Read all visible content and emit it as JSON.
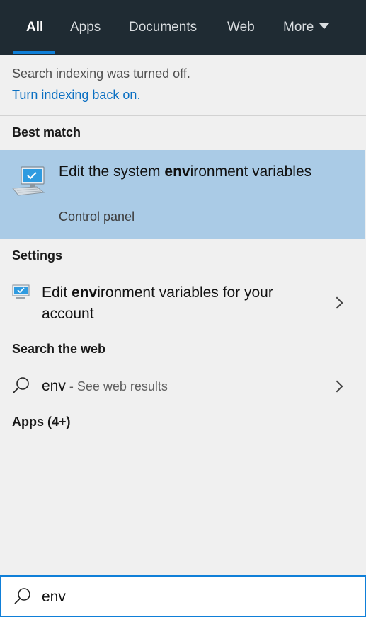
{
  "tabs": [
    {
      "label": "All",
      "active": true
    },
    {
      "label": "Apps",
      "active": false
    },
    {
      "label": "Documents",
      "active": false
    },
    {
      "label": "Web",
      "active": false
    },
    {
      "label": "More",
      "active": false
    }
  ],
  "notice": {
    "text": "Search indexing was turned off.",
    "link": "Turn indexing back on."
  },
  "best_match": {
    "heading": "Best match",
    "title_parts": [
      "Edit the system ",
      "env",
      "ironment variables"
    ],
    "subtitle": "Control panel",
    "icon": "system-environment-icon"
  },
  "settings": {
    "heading": "Settings",
    "item_parts": [
      "Edit ",
      "env",
      "ironment variables for your account"
    ],
    "icon": "monitor-settings-icon"
  },
  "web": {
    "heading": "Search the web",
    "query": "env",
    "hint": " - See web results",
    "icon": "search-icon"
  },
  "apps": {
    "heading": "Apps (4+)"
  },
  "search_box": {
    "value": "env",
    "icon": "search-icon"
  },
  "colors": {
    "tabbar_bg": "#1f2b33",
    "accent": "#0f7fd8",
    "highlight": "#aacbe6",
    "link": "#0a6fc2",
    "panel_bg": "#f0f0f0"
  }
}
